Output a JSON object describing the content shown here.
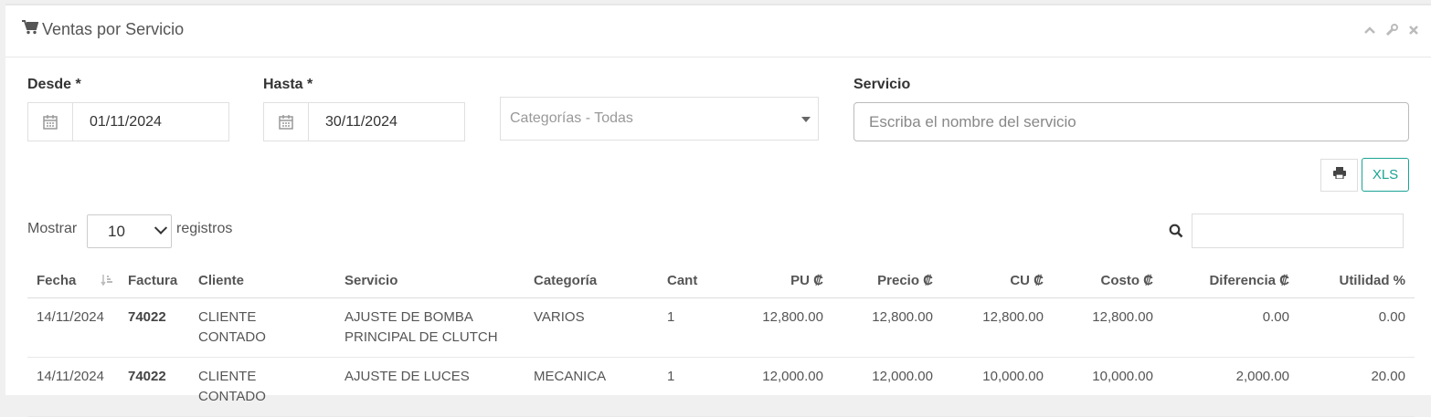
{
  "panel": {
    "title": "Ventas por Servicio"
  },
  "filters": {
    "desde_label": "Desde *",
    "desde_value": "01/11/2024",
    "hasta_label": "Hasta *",
    "hasta_value": "30/11/2024",
    "categoria_selected": "Categorías - Todas",
    "servicio_label": "Servicio",
    "servicio_placeholder": "Escriba el nombre del servicio"
  },
  "actions": {
    "xls_label": "XLS"
  },
  "table_controls": {
    "mostrar": "Mostrar",
    "page_length": "10",
    "registros": "registros"
  },
  "table": {
    "headers": [
      "Fecha",
      "Factura",
      "Cliente",
      "Servicio",
      "Categoría",
      "Cant",
      "PU ₡",
      "Precio ₡",
      "CU ₡",
      "Costo ₡",
      "Diferencia ₡",
      "Utilidad %"
    ],
    "rows": [
      {
        "fecha": "14/11/2024",
        "factura": "74022",
        "cliente": "CLIENTE CONTADO",
        "servicio": "AJUSTE DE BOMBA PRINCIPAL DE CLUTCH",
        "categoria": "VARIOS",
        "cant": "1",
        "pu": "12,800.00",
        "precio": "12,800.00",
        "cu": "12,800.00",
        "costo": "12,800.00",
        "diferencia": "0.00",
        "utilidad": "0.00"
      },
      {
        "fecha": "14/11/2024",
        "factura": "74022",
        "cliente": "CLIENTE CONTADO",
        "servicio": "AJUSTE DE LUCES",
        "categoria": "MECANICA",
        "cant": "1",
        "pu": "12,000.00",
        "precio": "12,000.00",
        "cu": "10,000.00",
        "costo": "10,000.00",
        "diferencia": "2,000.00",
        "utilidad": "20.00"
      }
    ]
  }
}
